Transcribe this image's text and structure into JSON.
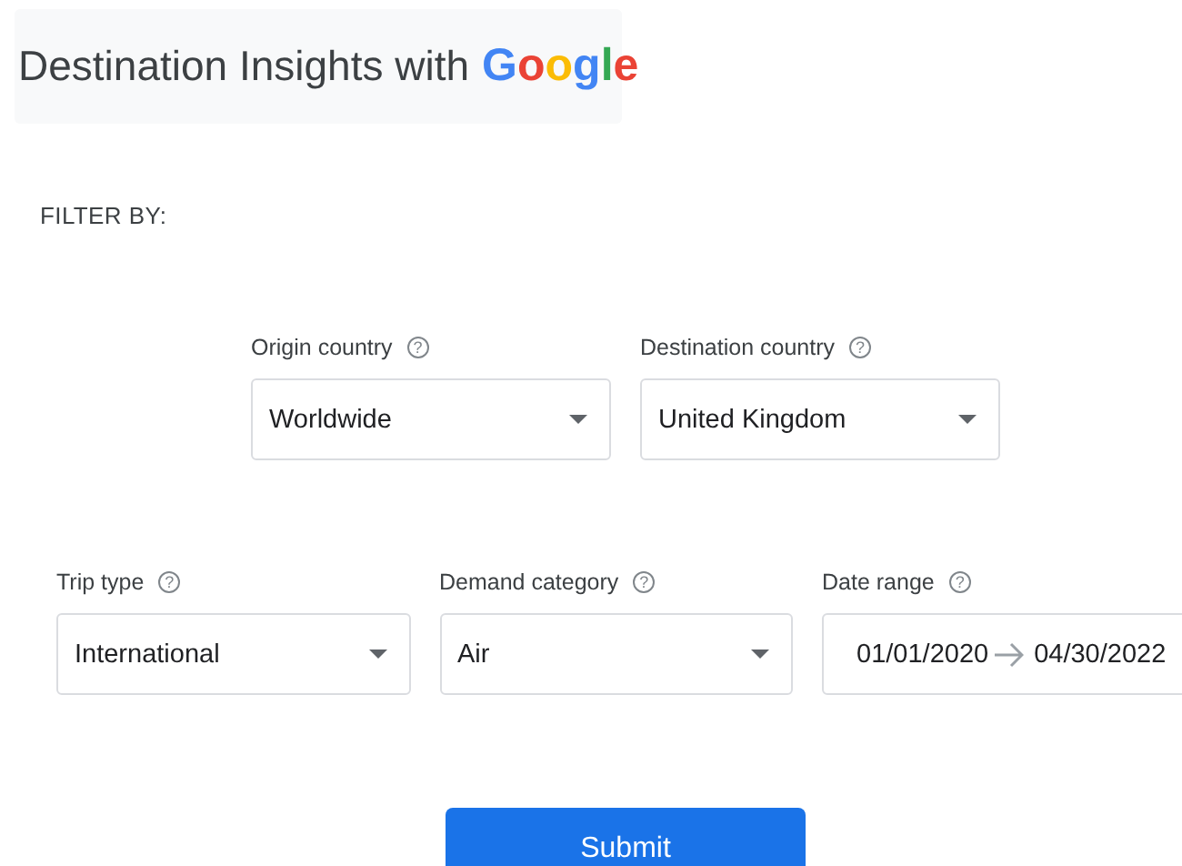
{
  "header": {
    "title": "Destination Insights with",
    "logo": "Google"
  },
  "filter_label": "FILTER BY:",
  "rows": [
    {
      "fields": [
        {
          "kind": "select",
          "label": "Origin country",
          "help": "?",
          "value": "Worldwide"
        },
        {
          "kind": "select",
          "label": "Destination country",
          "help": "?",
          "value": "United Kingdom"
        }
      ]
    },
    {
      "fields": [
        {
          "kind": "select",
          "label": "Trip type",
          "help": "?",
          "value": "International"
        },
        {
          "kind": "select",
          "label": "Demand category",
          "help": "?",
          "value": "Air"
        },
        {
          "kind": "date",
          "label": "Date range",
          "help": "?",
          "start": "01/01/2020",
          "end": "04/30/2022"
        }
      ]
    }
  ],
  "submit": "Submit"
}
